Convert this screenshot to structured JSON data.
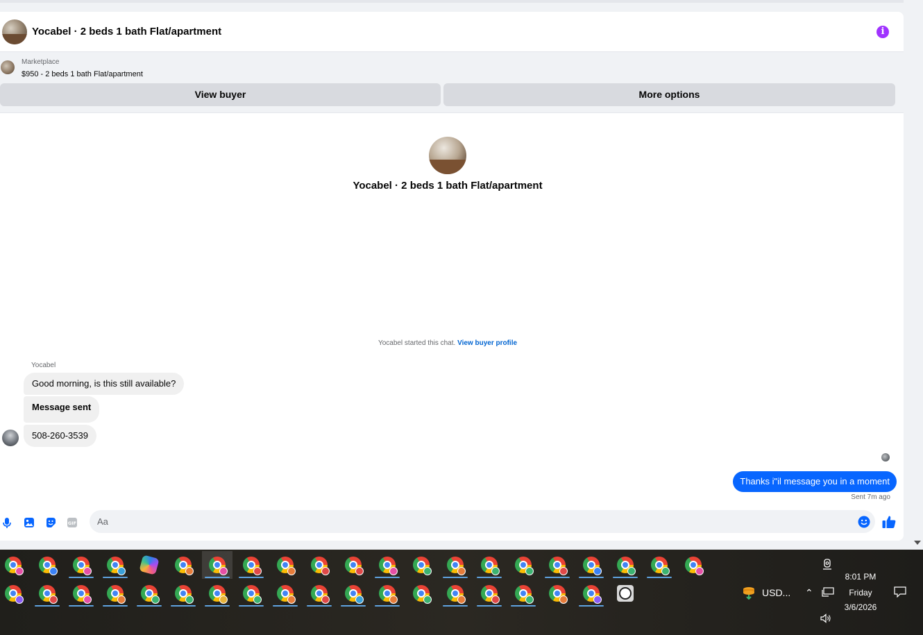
{
  "header": {
    "title": "Yocabel · 2 beds 1 bath Flat/apartment",
    "info_icon": "info-icon"
  },
  "listing": {
    "kind": "Marketplace",
    "title": "$950 - 2 beds 1 bath Flat/apartment",
    "view_buyer_label": "View buyer",
    "more_options_label": "More options"
  },
  "intro": {
    "name": "Yocabel · 2 beds 1 bath Flat/apartment"
  },
  "thread": {
    "started_text": "Yocabel started this chat.",
    "view_profile_link": "View buyer profile",
    "sender_name": "Yocabel",
    "incoming": [
      "Good morning, is this still available?",
      "Message sent",
      "508-260-3539"
    ],
    "outgoing": "Thanks i\"il message you in a moment",
    "sent_time": "Sent 7m ago"
  },
  "composer": {
    "placeholder": "Aa",
    "icons": [
      "mic-icon",
      "photo-icon",
      "sticker-icon",
      "gif-icon",
      "emoji-icon",
      "like-icon"
    ],
    "accent": "#0866ff"
  },
  "taskbar": {
    "row1_profile_colors": [
      "#e64fa6",
      "#3b82f6",
      "#e64fa6",
      "#3aa0d8",
      null,
      "#e67c3a",
      "#e64fa6",
      "#e04848",
      "#e67c3a",
      "#e04848",
      "#e04848",
      "#e64fa6",
      "#3cb371",
      "#e67c3a",
      "#3cb371",
      "#3cb371",
      "#e04848",
      "#3b82f6",
      "#3cb371",
      "#3cb371",
      "#e64fa6"
    ],
    "row2_profile_colors": [
      "#8a5cf6",
      "#e04848",
      "#e64fa6",
      "#e67c3a",
      "#3cb371",
      "#3cb371",
      "#e6b23a",
      "#3cb371",
      "#e67c3a",
      "#e04848",
      "#3aa0d8",
      "#e67c3a",
      "#3cb371",
      "#e67c3a",
      "#e04848",
      "#3cb371",
      "#e67c3a",
      "#8a5cf6",
      null
    ],
    "tray": {
      "ticker_label": "USD...",
      "time": "8:01 PM",
      "day": "Friday",
      "date": "3/6/2026"
    }
  }
}
